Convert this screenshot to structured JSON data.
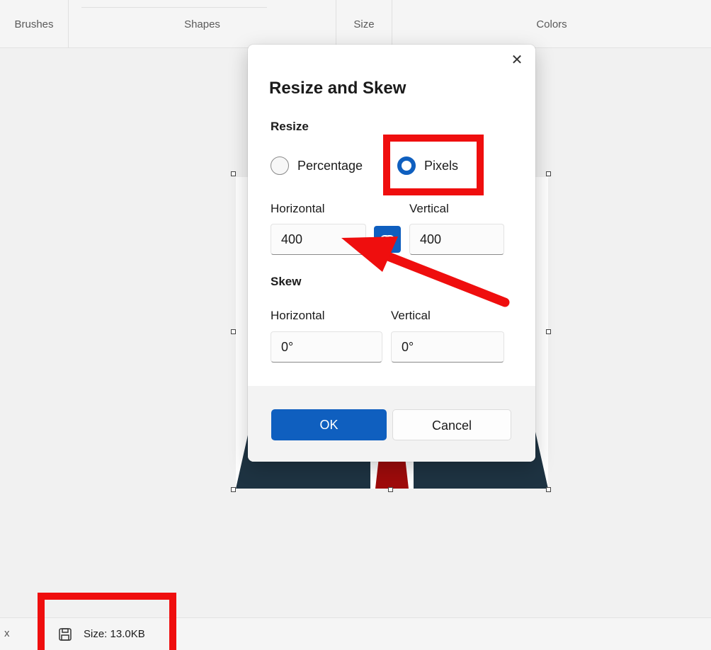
{
  "toolbar": {
    "groups": [
      "Brushes",
      "Shapes",
      "Size",
      "Colors"
    ]
  },
  "dialog": {
    "title": "Resize and Skew",
    "close_glyph": "✕",
    "resize": {
      "section_label": "Resize",
      "options": [
        "Percentage",
        "Pixels"
      ],
      "selected": "Pixels",
      "horizontal_label": "Horizontal",
      "vertical_label": "Vertical",
      "horizontal_value": "400",
      "vertical_value": "400",
      "aspect_lock_icon": "link-icon"
    },
    "skew": {
      "section_label": "Skew",
      "horizontal_label": "Horizontal",
      "vertical_label": "Vertical",
      "horizontal_value": "0°",
      "vertical_value": "0°"
    },
    "ok_label": "OK",
    "cancel_label": "Cancel"
  },
  "statusbar": {
    "left_glyph": "x",
    "save_icon": "save-icon",
    "size_text": "Size: 13.0KB"
  },
  "colors": {
    "accent": "#0f5fbf",
    "annotation": "#ef0e0e",
    "suit": "#1e3342",
    "tie": "#9e0b0b"
  }
}
